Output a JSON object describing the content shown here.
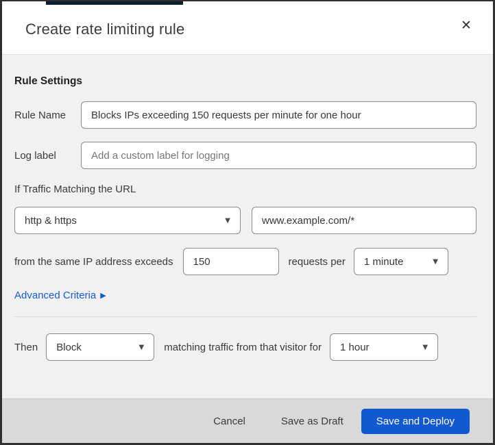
{
  "colors": {
    "primary_button_blue": "#1159d1",
    "link_blue": "#155bd4",
    "body_background": "#f1f1f1",
    "footer_background": "#d9d9d9",
    "top_strip_fragment": "#0b1e2d",
    "input_border": "#8a8a8a"
  },
  "icons": {
    "close": "✕",
    "caret_down": "▼",
    "arrow_right": "▶"
  },
  "header": {
    "title": "Create rate limiting rule"
  },
  "form": {
    "section_heading": "Rule Settings",
    "rule_name": {
      "label": "Rule Name",
      "value": "Blocks IPs exceeding 150 requests per minute for one hour"
    },
    "log_label": {
      "label": "Log label",
      "placeholder": "Add a custom label for logging"
    },
    "traffic_match": {
      "intro": "If Traffic Matching the URL",
      "scheme_selected": "http & https",
      "url_value": "www.example.com/*"
    },
    "threshold": {
      "prefix": "from the same IP address exceeds",
      "requests_value": "150",
      "middle": "requests per",
      "period_selected": "1 minute"
    },
    "advanced_criteria": {
      "label": "Advanced Criteria"
    },
    "action": {
      "prefix": "Then",
      "action_selected": "Block",
      "middle": "matching traffic from that visitor for",
      "duration_selected": "1 hour"
    }
  },
  "footer": {
    "cancel_label": "Cancel",
    "save_draft_label": "Save as Draft",
    "save_deploy_label": "Save and Deploy"
  }
}
